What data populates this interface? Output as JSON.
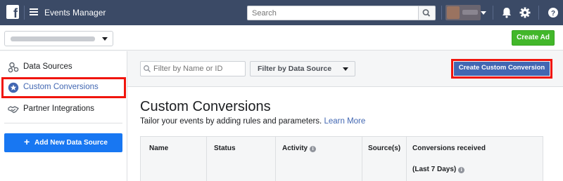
{
  "topbar": {
    "title": "Events Manager",
    "search_placeholder": "Search"
  },
  "subbar": {
    "create_ad_label": "Create Ad"
  },
  "sidebar": {
    "items": [
      {
        "label": "Data Sources",
        "icon": "data-sources-icon"
      },
      {
        "label": "Custom Conversions",
        "icon": "star-badge-icon",
        "active": true
      },
      {
        "label": "Partner Integrations",
        "icon": "handshake-icon"
      }
    ],
    "add_button_label": "Add New Data Source"
  },
  "filters": {
    "name_placeholder": "Filter by Name or ID",
    "source_select_label": "Filter by Data Source"
  },
  "main": {
    "create_button_label": "Create Custom Conversion",
    "title": "Custom Conversions",
    "description": "Tailor your events by adding rules and parameters.",
    "learn_more": "Learn More"
  },
  "table": {
    "columns": [
      {
        "label": "Name"
      },
      {
        "label": "Status"
      },
      {
        "label": "Activity"
      },
      {
        "label": "Source(s)"
      },
      {
        "label": "Conversions received",
        "sublabel": "(Last 7 Days)"
      }
    ]
  },
  "colors": {
    "topbar": "#3b4a66",
    "accent_blue": "#4267b2",
    "primary_button": "#1877f2",
    "green_button": "#42b72a",
    "highlight_red": "#f0150d"
  }
}
